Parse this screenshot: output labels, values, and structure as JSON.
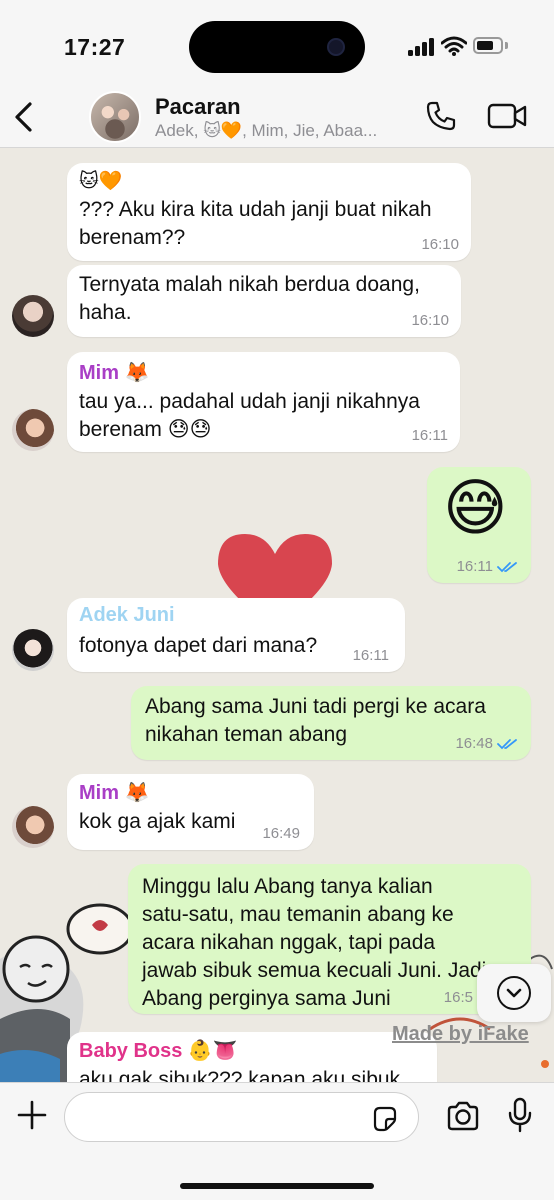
{
  "status_bar": {
    "time": "17:27"
  },
  "header": {
    "title": "Pacaran",
    "subtitle": "Adek, 🐱🧡, Mim, Jie, Abaa..."
  },
  "messages": [
    {
      "sender": "🐱🧡",
      "text": "??? Aku kira kita udah janji buat nikah\nberenam??",
      "time": "16:10"
    },
    {
      "text": "Ternyata malah nikah berdua doang,\nhaha.",
      "time": "16:10"
    },
    {
      "sender": "Mim 🦊",
      "text": "tau ya... padahal udah janji nikahnya\nberenam 😓😓",
      "time": "16:11"
    },
    {
      "emoji": "😅",
      "time": "16:11"
    },
    {
      "sender": "Adek Juni",
      "text": "fotonya dapet dari mana?",
      "time": "16:11"
    },
    {
      "text": "Abang sama Juni tadi pergi ke acara\nnikahan teman abang",
      "time": "16:48"
    },
    {
      "sender": "Mim 🦊",
      "text": "kok ga ajak kami",
      "time": "16:49"
    },
    {
      "text": "Minggu lalu Abang tanya kalian\nsatu-satu, mau temanin abang ke\nacara nikahan nggak, tapi pada\njawab sibuk semua kecuali Juni. Jadi\nAbang perginya sama Juni",
      "time": "16:5"
    },
    {
      "sender": "Baby Boss 👶👅",
      "text": "aku gak sibuk??? kapan aku sibuk"
    }
  ],
  "watermark": "Made by iFake",
  "input": {
    "placeholder": ""
  },
  "colors": {
    "incoming_bubble": "#ffffff",
    "outgoing_bubble": "#dcf8c6",
    "sender_mim": "#a93fc6",
    "sender_adek_juni": "#9fd4f2",
    "sender_baby_boss": "#e0338a",
    "read_ticks": "#3497f9",
    "chat_background": "#ece9e2"
  },
  "icons": [
    "back-chevron-icon",
    "phone-icon",
    "video-camera-icon",
    "plus-icon",
    "sticker-icon",
    "camera-icon",
    "microphone-icon",
    "chevron-down-icon",
    "double-check-icon"
  ]
}
